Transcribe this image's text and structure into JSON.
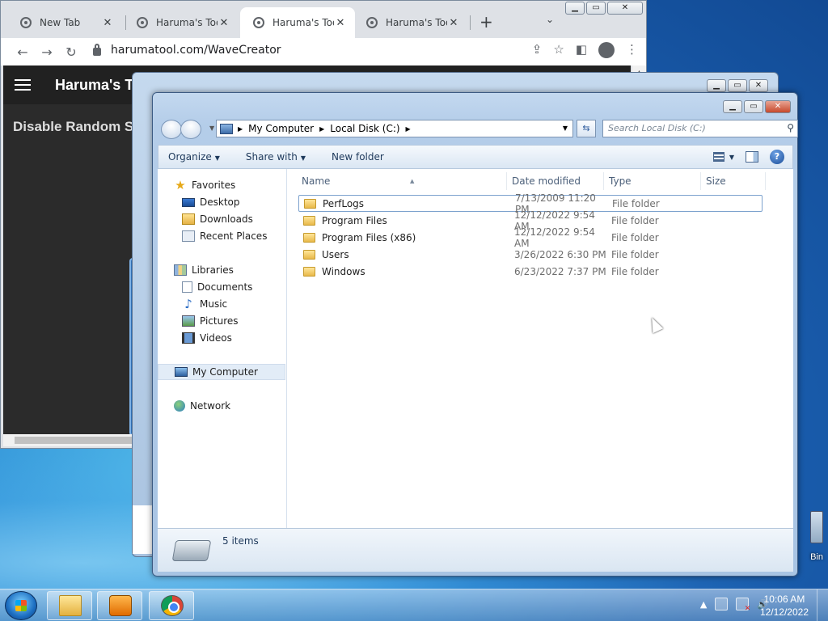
{
  "browser": {
    "tabs": [
      {
        "title": "New Tab",
        "icon": "chrome-icon"
      },
      {
        "title": "Haruma's Tool",
        "icon": "globe-icon"
      },
      {
        "title": "Haruma's Tool",
        "icon": "globe-icon",
        "active": true
      },
      {
        "title": "Haruma's Tool",
        "icon": "globe-icon"
      }
    ],
    "new_tab_symbol": "+",
    "url": "harumatool.com/WaveCreator",
    "page": {
      "site_title": "Haruma's Tool",
      "heading": "Disable Random Spawns"
    }
  },
  "explorer": {
    "address": {
      "root": "My Computer",
      "current": "Local Disk (C:)"
    },
    "search_placeholder": "Search Local Disk (C:)",
    "commands": {
      "organize": "Organize",
      "share_with": "Share with",
      "new_folder": "New folder"
    },
    "nav": {
      "favorites": "Favorites",
      "desktop": "Desktop",
      "downloads": "Downloads",
      "recent_places": "Recent Places",
      "libraries": "Libraries",
      "documents": "Documents",
      "music": "Music",
      "pictures": "Pictures",
      "videos": "Videos",
      "my_computer": "My Computer",
      "network": "Network"
    },
    "columns": {
      "name": "Name",
      "date": "Date modified",
      "type": "Type",
      "size": "Size"
    },
    "files": [
      {
        "name": "PerfLogs",
        "date": "7/13/2009 11:20 PM",
        "type": "File folder"
      },
      {
        "name": "Program Files",
        "date": "12/12/2022 9:54 AM",
        "type": "File folder"
      },
      {
        "name": "Program Files (x86)",
        "date": "12/12/2022 9:54 AM",
        "type": "File folder"
      },
      {
        "name": "Users",
        "date": "3/26/2022 6:30 PM",
        "type": "File folder"
      },
      {
        "name": "Windows",
        "date": "6/23/2022 7:37 PM",
        "type": "File folder"
      }
    ],
    "status": "5 items"
  },
  "desktop": {
    "recycle_bin_label": "Bin"
  },
  "taskbar": {
    "time": "10:06 AM",
    "date": "12/12/2022"
  }
}
